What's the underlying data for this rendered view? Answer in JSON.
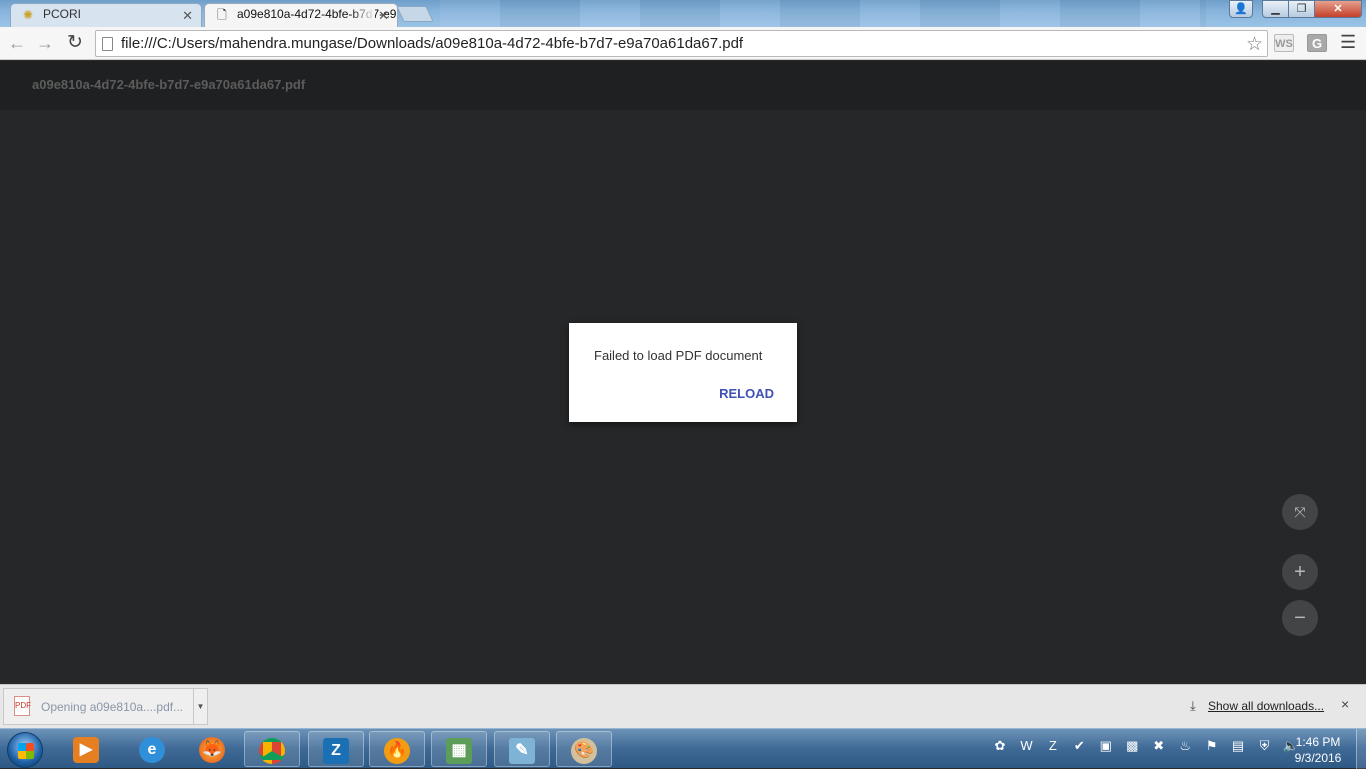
{
  "browser": {
    "tabs": [
      {
        "title": "PCORI",
        "active": false
      },
      {
        "title": "a09e810a-4d72-4bfe-b7d7-e9a70a61da67.pdf",
        "active": true
      }
    ],
    "address": "file:///C:/Users/mahendra.mungase/Downloads/a09e810a-4d72-4bfe-b7d7-e9a70a61da67.pdf",
    "extensions": {
      "ws": "WS",
      "g": "G"
    }
  },
  "pdf_viewer": {
    "title": "a09e810a-4d72-4bfe-b7d7-e9a70a61da67.pdf",
    "error_message": "Failed to load PDF document",
    "reload_label": "RELOAD",
    "controls": {
      "fit": "⤧",
      "zoom_in": "+",
      "zoom_out": "−"
    }
  },
  "download_shelf": {
    "item_label": "Opening a09e810a....pdf...",
    "show_all": "Show all downloads...",
    "close": "×"
  },
  "taskbar": {
    "clock_time": "1:46 PM",
    "clock_date": "9/3/2016"
  },
  "colors": {
    "viewer_bg": "#262729",
    "toolbar_bg": "#1f2022",
    "reload_accent": "#3f51b5"
  }
}
